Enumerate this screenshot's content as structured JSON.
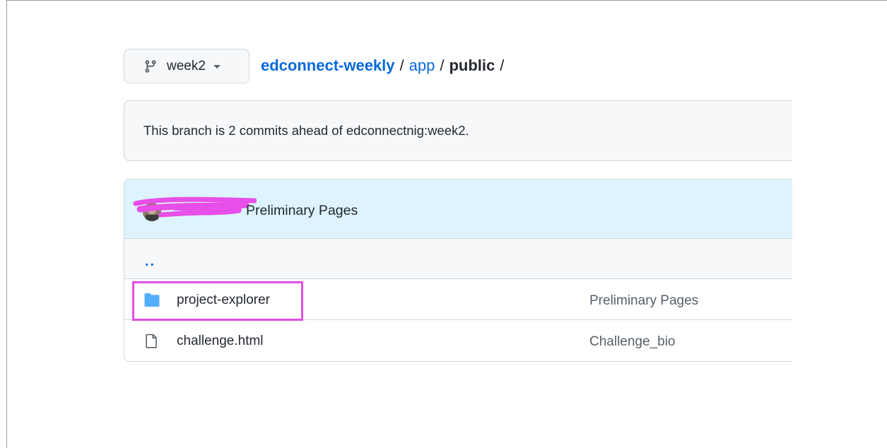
{
  "branch": {
    "name": "week2",
    "icon": "git-branch-icon"
  },
  "breadcrumb": {
    "repo": "edconnect-weekly",
    "folder": "app",
    "current": "public",
    "separator": "/"
  },
  "ahead_notice": "This branch is 2 commits ahead of edconnectnig:week2.",
  "latest_commit": {
    "message": "Preliminary Pages"
  },
  "parent_link": "..",
  "files": [
    {
      "type": "directory",
      "icon": "folder-icon",
      "name": "project-explorer",
      "commit_message": "Preliminary Pages"
    },
    {
      "type": "file",
      "icon": "file-icon",
      "name": "challenge.html",
      "commit_message": "Challenge_bio"
    }
  ],
  "colors": {
    "link": "#0969da",
    "folder": "#54aeff",
    "highlight": "#e052e0",
    "redaction": "#e84ee8",
    "commit_row_bg": "#ddf4ff"
  }
}
